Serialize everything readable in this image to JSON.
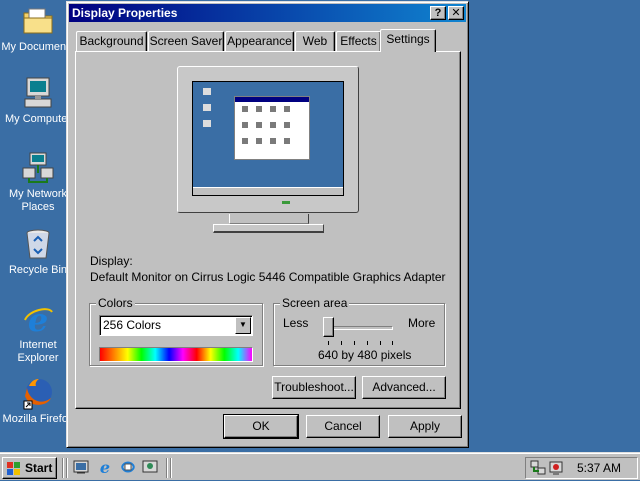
{
  "desktop": {
    "icons": [
      {
        "label": "My Documents",
        "icon": "folder-documents-icon"
      },
      {
        "label": "My Computer",
        "icon": "computer-icon"
      },
      {
        "label": "My Network Places",
        "icon": "network-places-icon"
      },
      {
        "label": "Recycle Bin",
        "icon": "recycle-bin-icon"
      },
      {
        "label": "Internet Explorer",
        "icon": "internet-explorer-icon"
      },
      {
        "label": "Mozilla Firefox",
        "icon": "firefox-icon"
      }
    ]
  },
  "window": {
    "title": "Display Properties",
    "help_glyph": "?",
    "close_glyph": "✕",
    "tabs": [
      {
        "label": "Background"
      },
      {
        "label": "Screen Saver"
      },
      {
        "label": "Appearance"
      },
      {
        "label": "Web"
      },
      {
        "label": "Effects"
      },
      {
        "label": "Settings",
        "active": true
      }
    ],
    "display_label": "Display:",
    "display_value": "Default Monitor on Cirrus Logic 5446 Compatible Graphics Adapter",
    "colors": {
      "legend": "Colors",
      "selected": "256 Colors"
    },
    "screen_area": {
      "legend": "Screen area",
      "less": "Less",
      "more": "More",
      "value": "640 by 480 pixels",
      "slider_position": 0
    },
    "buttons": {
      "troubleshoot": "Troubleshoot...",
      "advanced": "Advanced...",
      "ok": "OK",
      "cancel": "Cancel",
      "apply": "Apply"
    }
  },
  "taskbar": {
    "start_label": "Start",
    "quick_launch": [
      "show-desktop-icon",
      "internet-explorer-icon",
      "outlook-express-icon",
      "media-icon"
    ],
    "clock": "5:37 AM"
  },
  "colors": {
    "desktop": "#3a6ea5",
    "title_active": "#000080",
    "face": "#c0c0c0"
  }
}
